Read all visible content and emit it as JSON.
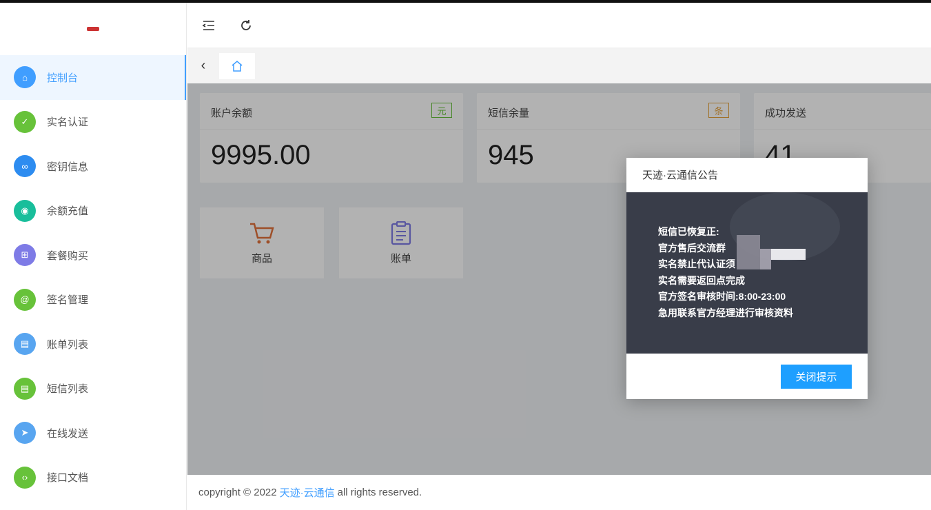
{
  "sidebar": {
    "items": [
      {
        "label": "控制台",
        "icon": "home-icon",
        "color": "#409eff",
        "glyph": "⌂"
      },
      {
        "label": "实名认证",
        "icon": "shield-icon",
        "color": "#67c23a",
        "glyph": "✓"
      },
      {
        "label": "密钥信息",
        "icon": "link-icon",
        "color": "#2d8cf0",
        "glyph": "∞"
      },
      {
        "label": "余额充值",
        "icon": "recharge-icon",
        "color": "#19be9b",
        "glyph": "◉"
      },
      {
        "label": "套餐购买",
        "icon": "cart-icon",
        "color": "#7e7be6",
        "glyph": "⊞"
      },
      {
        "label": "签名管理",
        "icon": "at-icon",
        "color": "#67c23a",
        "glyph": "@"
      },
      {
        "label": "账单列表",
        "icon": "document-icon",
        "color": "#58a5f0",
        "glyph": "▤"
      },
      {
        "label": "短信列表",
        "icon": "document-icon",
        "color": "#67c23a",
        "glyph": "▤"
      },
      {
        "label": "在线发送",
        "icon": "send-icon",
        "color": "#58a5f0",
        "glyph": "➤"
      },
      {
        "label": "接口文档",
        "icon": "code-icon",
        "color": "#67c23a",
        "glyph": "‹›"
      }
    ]
  },
  "stats": [
    {
      "title": "账户余额",
      "badge": "元",
      "value": "9995.00",
      "badge_color": "#67c23a"
    },
    {
      "title": "短信余量",
      "badge": "条",
      "value": "945",
      "badge_color": "#e6a23c"
    },
    {
      "title": "成功发送",
      "value": "41"
    }
  ],
  "quick": [
    {
      "label": "商品",
      "icon": "cart-icon",
      "color": "#e2723b"
    },
    {
      "label": "账单",
      "icon": "clipboard-icon",
      "color": "#7e7be6"
    }
  ],
  "footer": {
    "prefix": "copyright © 2022",
    "brand": "天迹·云通信",
    "suffix": "all rights reserved."
  },
  "modal": {
    "title": "天迹·云通信公告",
    "lines": [
      "短信已恢复正:",
      "官方售后交流群",
      "实名禁止代认证须",
      "实名需要返回点完成",
      "官方签名审核时间:8:00-23:00",
      "急用联系官方经理进行审核资料"
    ],
    "button": "关闭提示"
  }
}
